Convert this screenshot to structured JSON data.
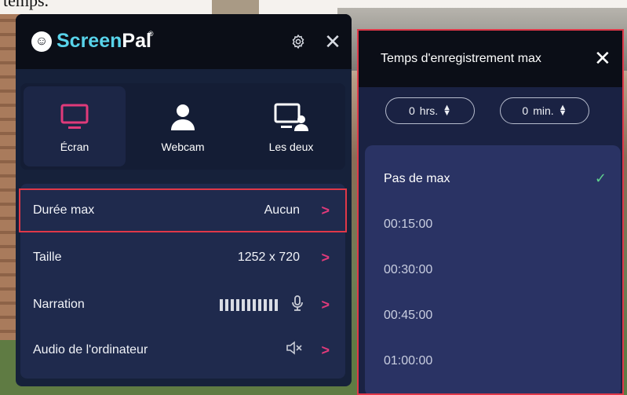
{
  "background_caption": "temps.",
  "panel": {
    "logo": {
      "screen": "Screen",
      "pal": "Pal",
      "reg": "®"
    },
    "modes": [
      {
        "label": "Écran",
        "icon": "monitor-icon",
        "active": true
      },
      {
        "label": "Webcam",
        "icon": "person-icon",
        "active": false
      },
      {
        "label": "Les deux",
        "icon": "monitor-person-icon",
        "active": false
      }
    ],
    "rows": [
      {
        "label": "Durée max",
        "value": "Aucun"
      },
      {
        "label": "Taille",
        "value": "1252 x 720"
      },
      {
        "label": "Narration",
        "value": ""
      },
      {
        "label": "Audio de l'ordinateur",
        "value": ""
      }
    ]
  },
  "dropdown": {
    "title": "Temps d'enregistrement max",
    "hours": {
      "value": "0",
      "unit": "hrs."
    },
    "minutes": {
      "value": "0",
      "unit": "min."
    },
    "options": [
      {
        "label": "Pas de max",
        "selected": true
      },
      {
        "label": "00:15:00",
        "selected": false
      },
      {
        "label": "00:30:00",
        "selected": false
      },
      {
        "label": "00:45:00",
        "selected": false
      },
      {
        "label": "01:00:00",
        "selected": false
      }
    ]
  },
  "colors": {
    "accent_pink": "#e03a7a",
    "highlight_red": "#e03848",
    "check_green": "#5fcf8e",
    "logo_cyan": "#58d3ea"
  }
}
